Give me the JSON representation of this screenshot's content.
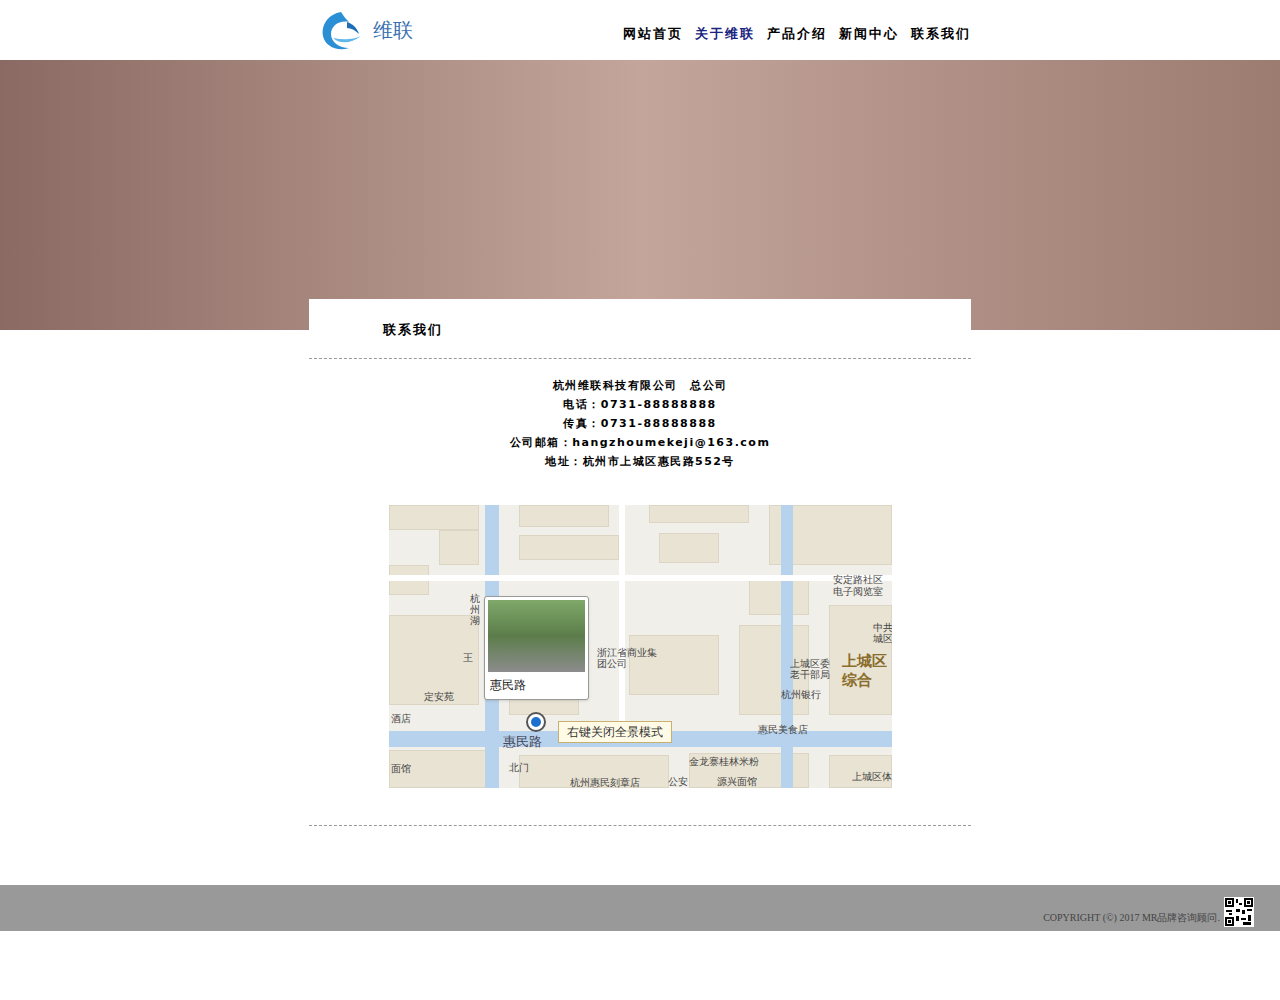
{
  "logo": {
    "text": "维联"
  },
  "nav": [
    {
      "label": "网站首页",
      "selected": false
    },
    {
      "label": "关于维联",
      "selected": true
    },
    {
      "label": "产品介绍",
      "selected": false
    },
    {
      "label": "新闻中心",
      "selected": false
    },
    {
      "label": "联系我们",
      "selected": false
    }
  ],
  "section_title": "联系我们",
  "contact": {
    "company": "杭州维联科技有限公司　总公司",
    "lines": [
      "电话：0731-88888888",
      "传真：0731-88888888",
      "公司邮箱：hangzhoumekeji@163.com",
      "地址：杭州市上城区惠民路552号"
    ]
  },
  "map": {
    "labels": [
      "浙江省商业集团公司",
      "上城区综合",
      "惠民美食店",
      "杭州银行",
      "上城区委老干部局",
      "中共城区",
      "安定路社区电子阅览室",
      "定安苑",
      "王",
      "杭州湖",
      "惠民路",
      "北门",
      "金龙寨桂林米粉",
      "杭州惠民刻章店",
      "公安",
      "源兴面馆",
      "上城区体",
      "酒店",
      "面馆"
    ],
    "popup": {
      "title": "惠民路"
    },
    "hint": "右键关闭全景模式"
  },
  "footer": {
    "copyright": "COPYRIGHT (©) 2017 MR品牌咨询顾问."
  }
}
